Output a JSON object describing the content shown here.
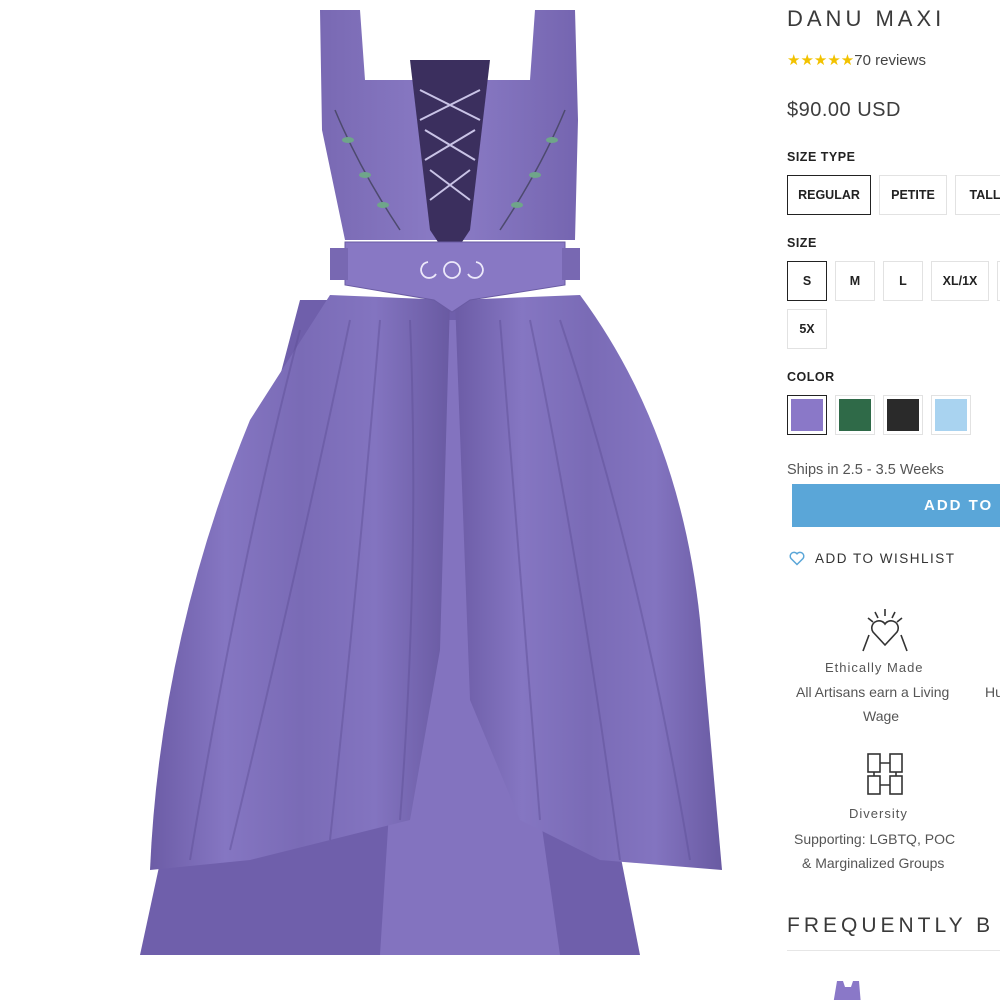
{
  "product": {
    "title": "DANU MAXI",
    "stars": "★★★★★",
    "reviews": "70 reviews",
    "price": "$90.00 USD"
  },
  "size_type": {
    "label": "SIZE TYPE",
    "options": [
      "REGULAR",
      "PETITE",
      "TALL"
    ],
    "selected": "REGULAR"
  },
  "size": {
    "label": "SIZE",
    "options": [
      "S",
      "M",
      "L",
      "XL/1X",
      "5X"
    ],
    "selected": "S"
  },
  "color": {
    "label": "COLOR",
    "swatches": [
      {
        "name": "purple",
        "hex": "#8a78c8"
      },
      {
        "name": "green",
        "hex": "#2f6a48"
      },
      {
        "name": "black",
        "hex": "#2a2a2a"
      },
      {
        "name": "light blue",
        "hex": "#a9d3f0"
      }
    ],
    "selected": "purple"
  },
  "shipping": "Ships in 2.5 - 3.5 Weeks",
  "add_to_cart": "ADD TO C",
  "wishlist": {
    "label": "ADD TO WISHLIST",
    "icon": "heart-icon"
  },
  "features": [
    {
      "icon": "heart-hands-icon",
      "title": "Ethically Made",
      "line1": "All Artisans earn a Living",
      "line2": "Wage",
      "clipped": "Hu"
    },
    {
      "icon": "diversity-hands-icon",
      "title": "Diversity",
      "line1": "Supporting: LGBTQ, POC",
      "line2": "& Marginalized Groups"
    }
  ],
  "frequently_bought": "FREQUENTLY B",
  "colors": {
    "accent": "#5aa6d8",
    "stars": "#f2c200",
    "dress": "#7e6fb8"
  }
}
